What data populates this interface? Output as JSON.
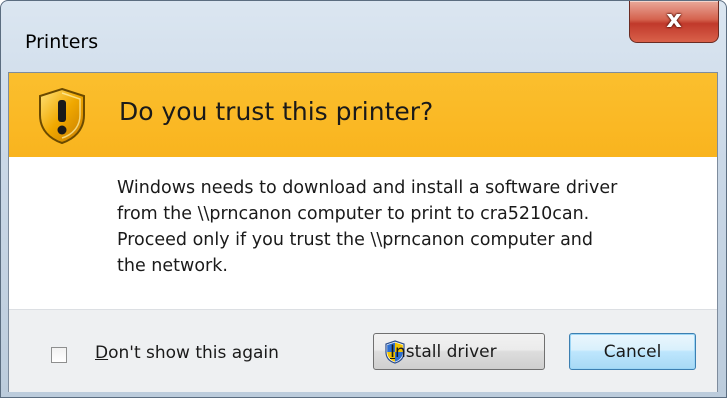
{
  "window": {
    "title": "Printers",
    "close_glyph": "x"
  },
  "banner": {
    "icon": "warning-shield-icon",
    "heading": "Do you trust this printer?",
    "color": "#f9b41e"
  },
  "message": {
    "lines": [
      "Windows needs to download and install a software driver",
      "from the \\\\prncanon computer to print to cra5210can.",
      "Proceed only if you trust the \\\\prncanon computer and",
      "the network."
    ]
  },
  "footer": {
    "checkbox_label_mnemonic": "D",
    "checkbox_label_rest": "on't show this again",
    "checkbox_checked": false,
    "install_button_mnemonic": "I",
    "install_button_rest": "nstall driver",
    "install_button_icon": "uac-shield-icon",
    "cancel_button_label": "Cancel"
  }
}
